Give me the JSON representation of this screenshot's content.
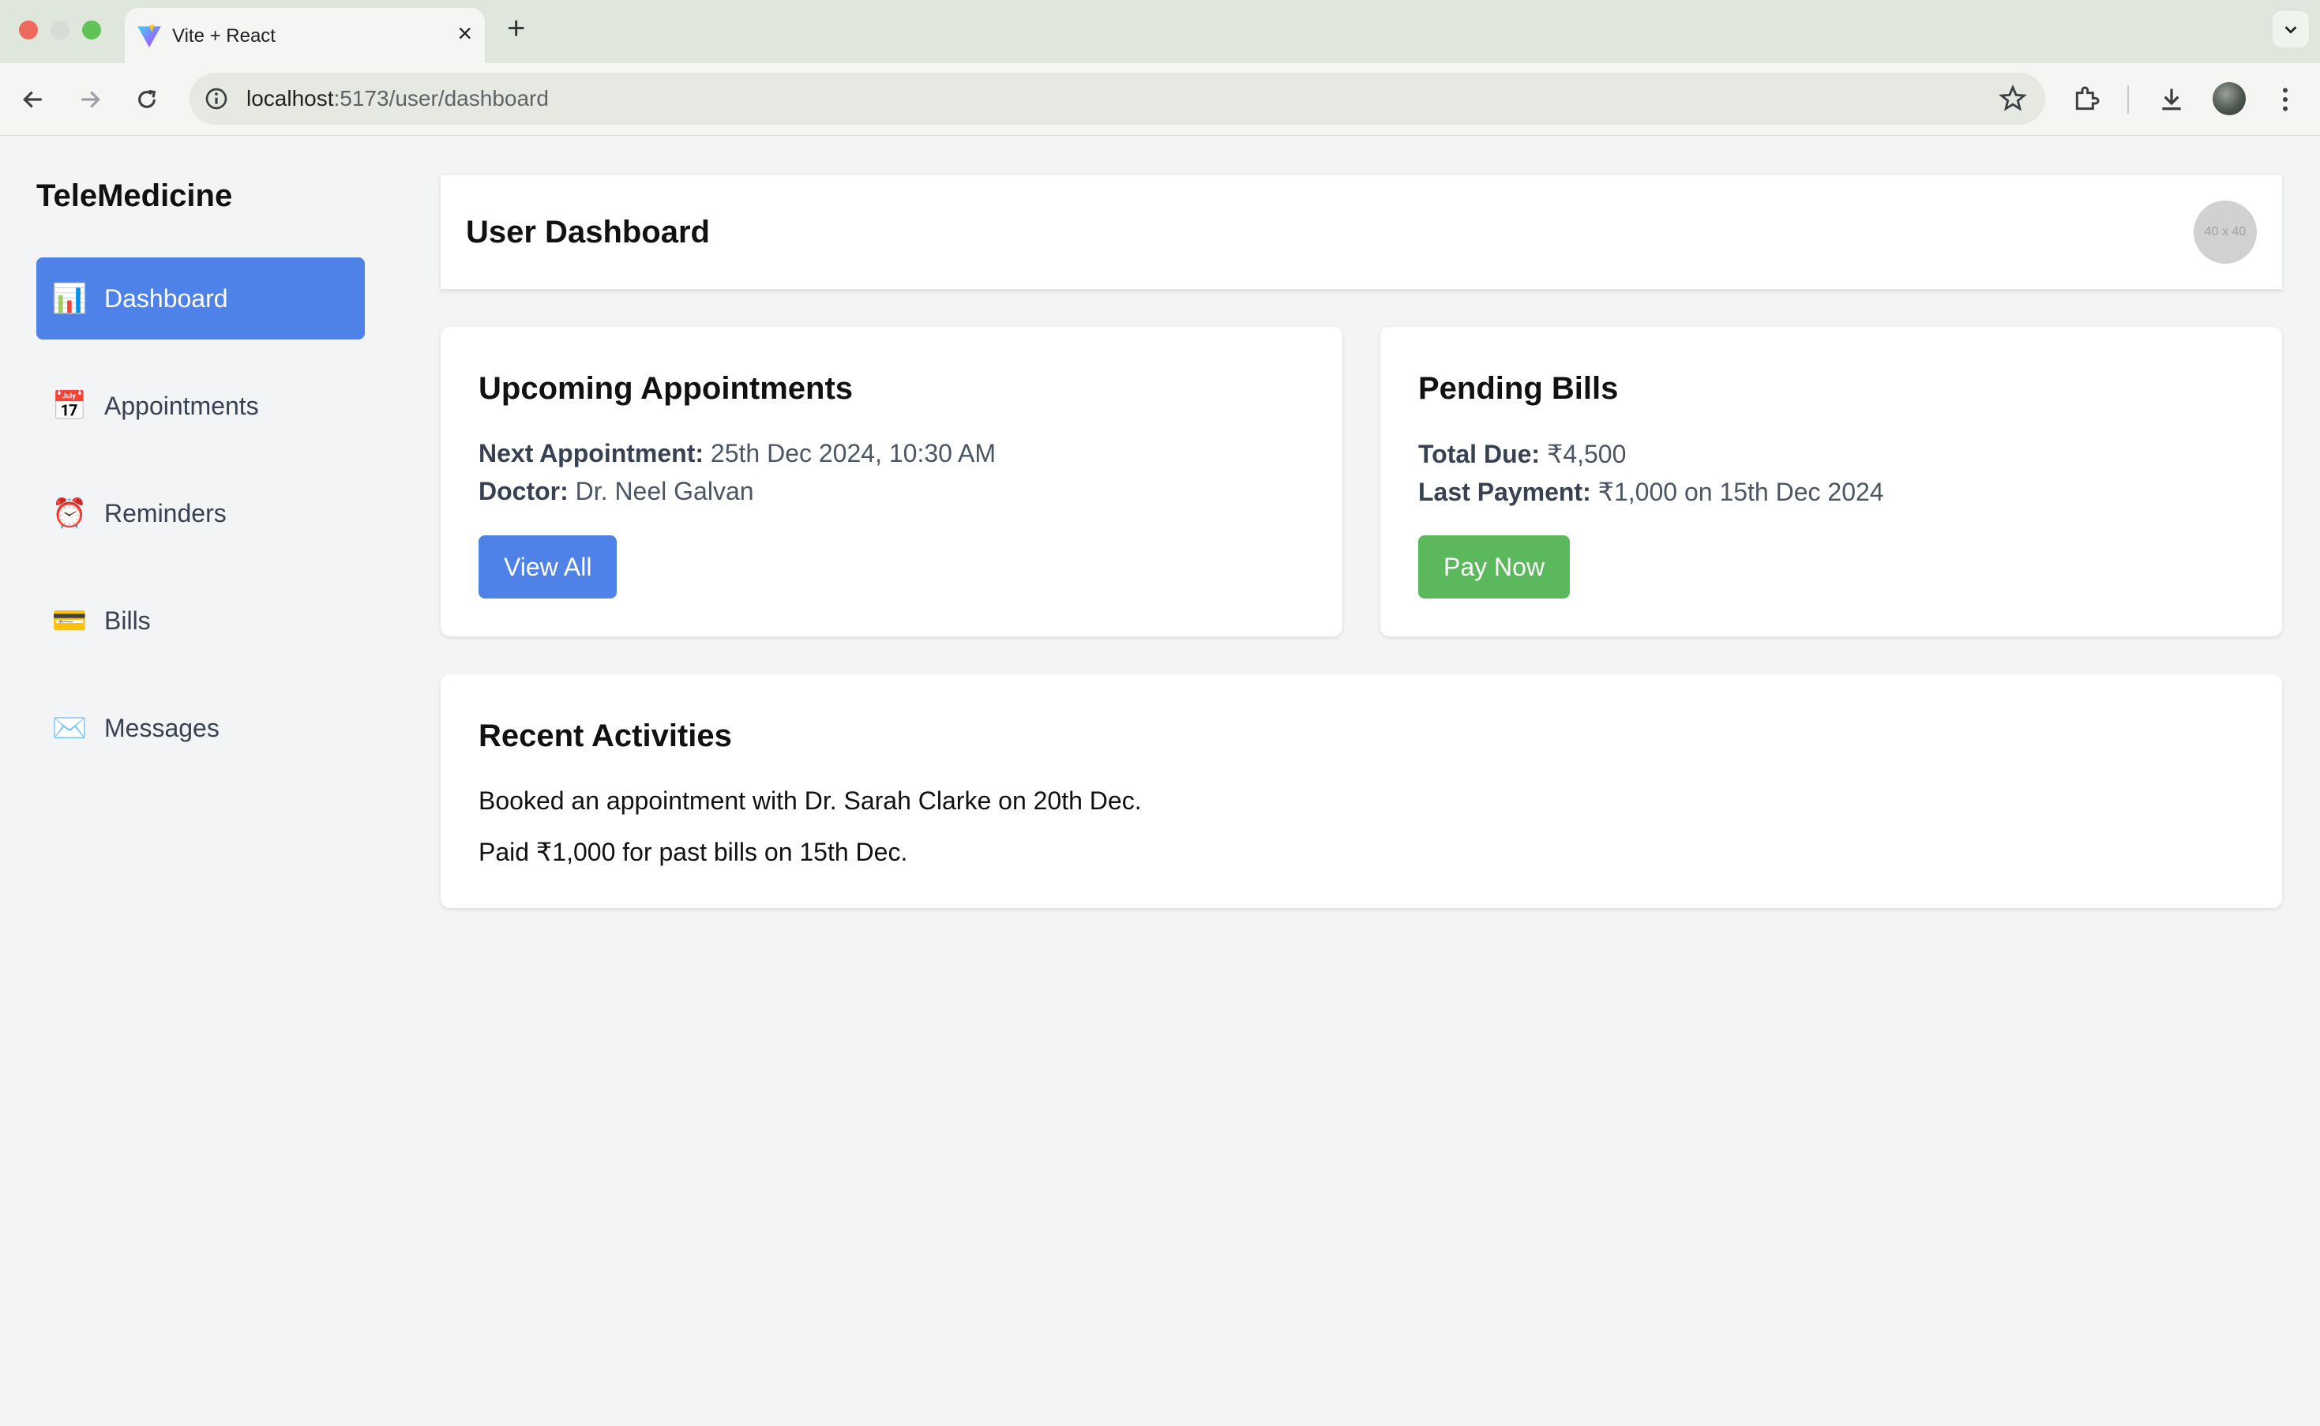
{
  "browser": {
    "tab_title": "Vite + React",
    "url_host": "localhost",
    "url_path": ":5173/user/dashboard"
  },
  "sidebar": {
    "brand": "TeleMedicine",
    "items": [
      {
        "label": "Dashboard",
        "icon": "📊",
        "icon_name": "bar-chart-icon",
        "active": true
      },
      {
        "label": "Appointments",
        "icon": "📅",
        "icon_name": "calendar-icon",
        "active": false
      },
      {
        "label": "Reminders",
        "icon": "⏰",
        "icon_name": "alarm-clock-icon",
        "active": false
      },
      {
        "label": "Bills",
        "icon": "💳",
        "icon_name": "credit-card-icon",
        "active": false
      },
      {
        "label": "Messages",
        "icon": "✉️",
        "icon_name": "envelope-icon",
        "active": false
      }
    ]
  },
  "header": {
    "title": "User Dashboard",
    "avatar_placeholder": "40 x 40"
  },
  "appointments": {
    "title": "Upcoming Appointments",
    "next_label": "Next Appointment:",
    "next_value": " 25th Dec 2024, 10:30 AM",
    "doctor_label": "Doctor:",
    "doctor_value": " Dr. Neel Galvan",
    "button": "View All"
  },
  "bills": {
    "title": "Pending Bills",
    "due_label": "Total Due:",
    "due_value": " ₹4,500",
    "last_label": "Last Payment:",
    "last_value": " ₹1,000 on 15th Dec 2024",
    "button": "Pay Now"
  },
  "activities": {
    "title": "Recent Activities",
    "items": [
      "Booked an appointment with Dr. Sarah Clarke on 20th Dec.",
      "Paid ₹1,000 for past bills on 15th Dec."
    ]
  },
  "colors": {
    "primary": "#4f82e8",
    "success": "#5cb85c",
    "background": "#f3f4f6"
  }
}
